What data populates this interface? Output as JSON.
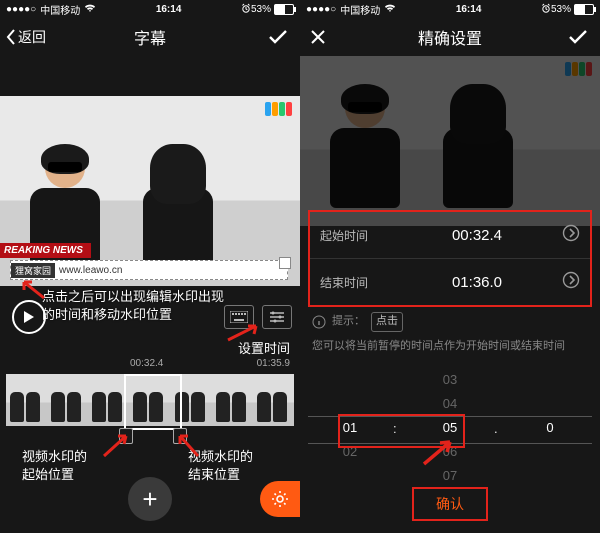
{
  "status": {
    "carrier": "中国移动",
    "time": "16:14",
    "battery_pct": "53%"
  },
  "left": {
    "nav": {
      "back": "返回",
      "title": "字幕"
    },
    "watermark": {
      "tag": "狸窝家园",
      "url": "www.leawo.cn"
    },
    "breaking": "REAKING NEWS",
    "anno_main": "点击之后可以出现编辑水印出现\n的时间和移动水印位置",
    "set_time_label": "设置时间",
    "tl_start": "00:32.4",
    "tl_end": "01:35.9",
    "anno_start": "视频水印的\n起始位置",
    "anno_end": "视频水印的\n结束位置"
  },
  "right": {
    "nav": {
      "title": "精确设置"
    },
    "rows": {
      "start_label": "起始时间",
      "start_val": "00:32.4",
      "end_label": "结束时间",
      "end_val": "01:36.0"
    },
    "hint": {
      "pre": "提示：",
      "chip": "点击",
      "post": "您可以将当前暂停的时间点作为开始时间或结束时间"
    },
    "picker": {
      "min": [
        "",
        "",
        "01",
        "02",
        ""
      ],
      "sec": [
        "03",
        "04",
        "05",
        "06",
        "07"
      ],
      "frac": [
        "",
        "",
        "0",
        "",
        ""
      ]
    },
    "confirm": "确认"
  }
}
